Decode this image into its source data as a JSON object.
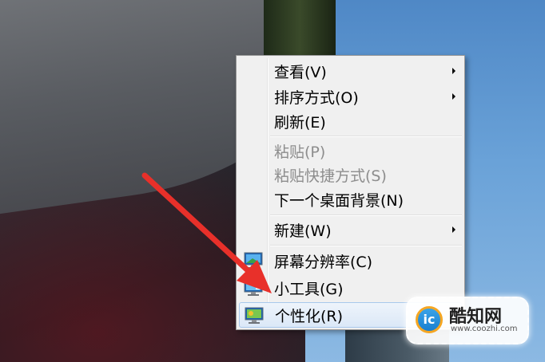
{
  "context_menu": {
    "items": [
      {
        "label": "查看(V)",
        "has_submenu": true,
        "enabled": true
      },
      {
        "label": "排序方式(O)",
        "has_submenu": true,
        "enabled": true
      },
      {
        "label": "刷新(E)",
        "has_submenu": false,
        "enabled": true
      },
      {
        "label": "粘贴(P)",
        "has_submenu": false,
        "enabled": false
      },
      {
        "label": "粘贴快捷方式(S)",
        "has_submenu": false,
        "enabled": false
      },
      {
        "label": "下一个桌面背景(N)",
        "has_submenu": false,
        "enabled": true
      },
      {
        "label": "新建(W)",
        "has_submenu": true,
        "enabled": true
      },
      {
        "label": "屏幕分辨率(C)",
        "has_submenu": false,
        "enabled": true,
        "icon": "display-icon"
      },
      {
        "label": "小工具(G)",
        "has_submenu": false,
        "enabled": true,
        "icon": "gadgets-icon"
      },
      {
        "label": "个性化(R)",
        "has_submenu": false,
        "enabled": true,
        "icon": "personalize-icon",
        "highlighted": true
      }
    ]
  },
  "watermark": {
    "logo_text": "ic",
    "title": "酷知网",
    "url": "www.coozhi.com"
  },
  "colors": {
    "menu_background": "#f0f0f0",
    "highlight": "#dbe8f7",
    "annotation_arrow": "#e8302a"
  }
}
